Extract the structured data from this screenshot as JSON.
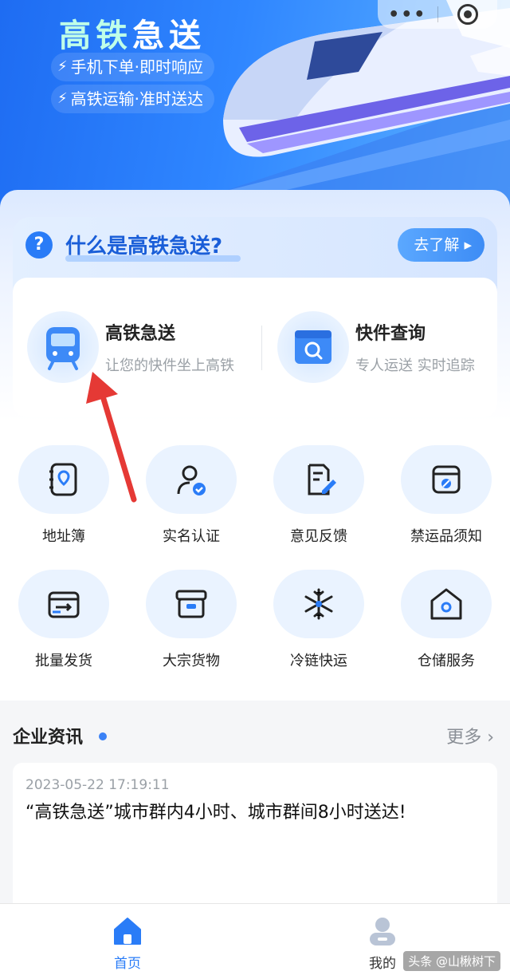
{
  "hero": {
    "title_part1": "高铁",
    "title_part2": "急送",
    "tag1": "手机下单·即时响应",
    "tag2": "高铁运输·准时送达",
    "capsule_more": "•••"
  },
  "whatis": {
    "question": "?",
    "title": "什么是高铁急送?",
    "learn_button": "去了解 ▸"
  },
  "services": [
    {
      "title": "高铁急送",
      "subtitle": "让您的快件坐上高铁",
      "icon": "train-icon"
    },
    {
      "title": "快件查询",
      "subtitle": "专人运送 实时追踪",
      "icon": "package-search-icon"
    }
  ],
  "grid": [
    {
      "label": "地址簿",
      "icon": "address-book-icon"
    },
    {
      "label": "实名认证",
      "icon": "verified-user-icon"
    },
    {
      "label": "意见反馈",
      "icon": "feedback-icon"
    },
    {
      "label": "禁运品须知",
      "icon": "prohibited-box-icon"
    },
    {
      "label": "批量发货",
      "icon": "batch-ship-icon"
    },
    {
      "label": "大宗货物",
      "icon": "bulk-cargo-icon"
    },
    {
      "label": "冷链快运",
      "icon": "snowflake-icon"
    },
    {
      "label": "仓储服务",
      "icon": "warehouse-icon"
    }
  ],
  "news": {
    "title": "企业资讯",
    "more": "更多 ›",
    "items": [
      {
        "time": "2023-05-22 17:19:11",
        "text": "“高铁急送”城市群内4小时、城市群间8小时送达!"
      }
    ]
  },
  "tabbar": {
    "home": "首页",
    "mine": "我的"
  },
  "watermark": "头条 @山楸树下",
  "colors": {
    "brand_blue": "#2a7cf7",
    "annotation_red": "#e53935"
  }
}
